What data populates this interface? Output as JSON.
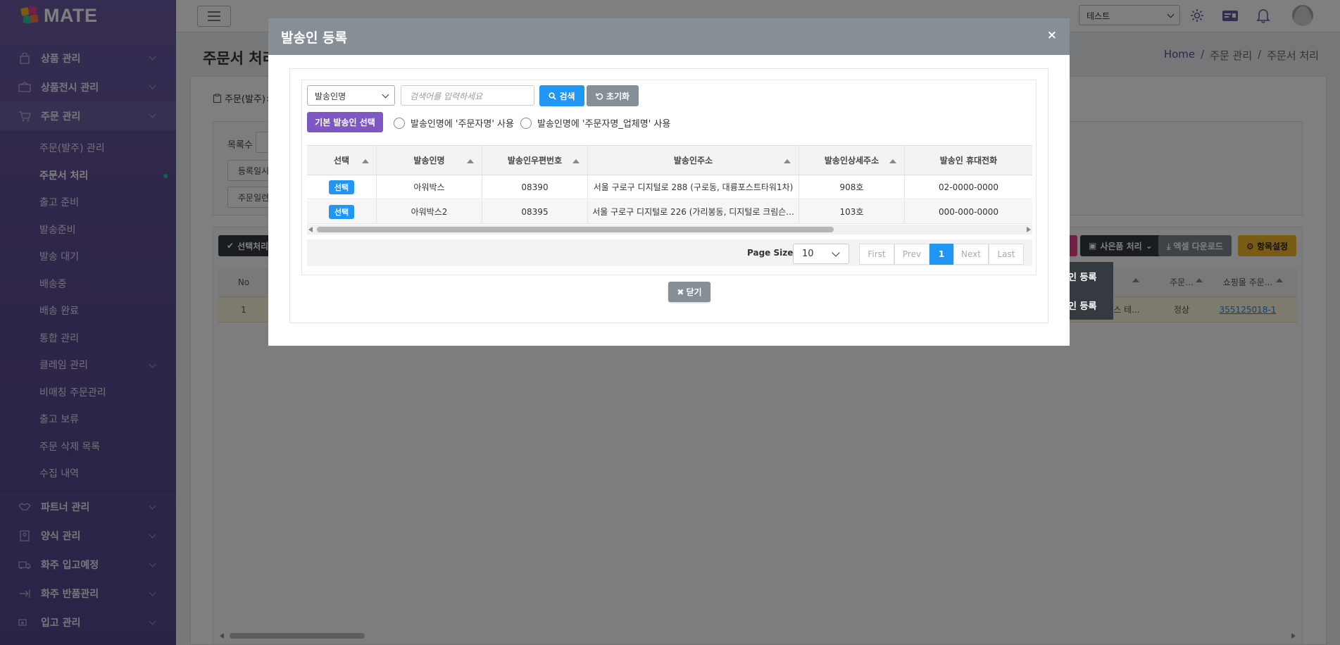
{
  "app": {
    "logo_text": "MATE"
  },
  "sidebar": {
    "items": [
      {
        "label": "상품 관리",
        "icon": "bag-icon"
      },
      {
        "label": "상품전시 관리",
        "icon": "display-icon"
      },
      {
        "label": "주문 관리",
        "icon": "cart-icon"
      }
    ],
    "sub_items": [
      {
        "label": "주문(발주) 관리"
      },
      {
        "label": "주문서 처리"
      },
      {
        "label": "출고 준비"
      },
      {
        "label": "발송준비"
      },
      {
        "label": "발송 대기"
      },
      {
        "label": "배송중"
      },
      {
        "label": "배송 완료"
      },
      {
        "label": "통합 관리"
      },
      {
        "label": "클레임 관리"
      },
      {
        "label": "비매칭 주문관리"
      },
      {
        "label": "출고 보류"
      },
      {
        "label": "주문 삭제 목록"
      },
      {
        "label": "수집 내역"
      }
    ],
    "bottom_items": [
      {
        "label": "파트너 관리",
        "icon": "handshake-icon"
      },
      {
        "label": "양식 관리",
        "icon": "form-icon"
      },
      {
        "label": "화주 입고예정",
        "icon": "truck-in-icon"
      },
      {
        "label": "화주 반품관리",
        "icon": "return-icon"
      },
      {
        "label": "입고 관리",
        "icon": "inbound-icon"
      }
    ]
  },
  "topbar": {
    "store_select": "테스트"
  },
  "page": {
    "title": "주문서 처리",
    "breadcrumb": [
      "Home",
      "/",
      "주문 관리",
      "/",
      "주문서 처리"
    ],
    "tab_label": "주문(발주)ㅊ",
    "filter": {
      "list_count_label": "목록수",
      "btn1": "등록일시",
      "btn2": "주문일련"
    },
    "toolbar": {
      "select_process": "선택처리",
      "gift_process": "사은품 처리",
      "excel_download": "엑셀 다운로드",
      "column_settings": "항목설정"
    },
    "dropdown": [
      "인 등록",
      "인 등록"
    ],
    "grid": {
      "headers": [
        "No",
        "주문...",
        "쇼핑몰 주문..."
      ],
      "row": {
        "no": "1",
        "partial": "스 테...",
        "status": "정상",
        "order_no": "355125018-1"
      }
    }
  },
  "modal": {
    "title": "발송인 등록",
    "close_icon": "×",
    "search": {
      "field_select": "발송인명",
      "placeholder": "검색어를 입력하세요",
      "search_btn": "검색",
      "reset_btn": "초기화"
    },
    "default_sender_btn": "기본 발송인 선택",
    "radio1": "발송인명에 '주문자명' 사용",
    "radio2": "발송인명에 '주문자명_업체명' 사용",
    "columns": [
      "선택",
      "발송인명",
      "발송인우편번호",
      "발송인주소",
      "발송인상세주소",
      "발송인 휴대전화"
    ],
    "rows": [
      {
        "select": "선택",
        "name": "아워박스",
        "zip": "08390",
        "address": "서울 구로구 디지털로 288 (구로동, 대륭포스트타워1차)",
        "detail": "908호",
        "phone": "02-0000-0000"
      },
      {
        "select": "선택",
        "name": "아워박스2",
        "zip": "08395",
        "address": "서울 구로구 디지털로 226 (가리봉동, 디지털로 크림슨...",
        "detail": "103호",
        "phone": "000-000-0000"
      }
    ],
    "pager": {
      "label": "Page Size",
      "size": "10",
      "first": "First",
      "prev": "Prev",
      "current": "1",
      "next": "Next",
      "last": "Last"
    },
    "close_btn": "닫기"
  }
}
